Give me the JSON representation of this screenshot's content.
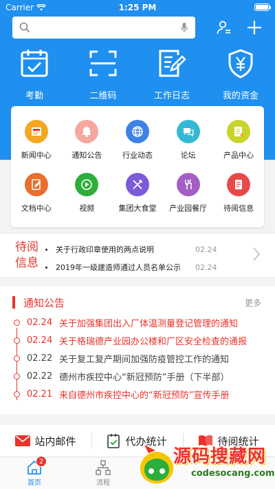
{
  "status_bar": {
    "carrier": "Carrier",
    "time": "1:25 PM"
  },
  "search": {
    "placeholder": ""
  },
  "quick_actions": [
    {
      "label": "考勤",
      "icon": "calendar-check-icon"
    },
    {
      "label": "二维码",
      "icon": "qr-scan-icon"
    },
    {
      "label": "工作日志",
      "icon": "work-log-icon"
    },
    {
      "label": "我的资金",
      "icon": "yuan-shield-icon"
    }
  ],
  "apps": [
    {
      "label": "新闻中心",
      "icon": "news-icon",
      "color": "#f5a623"
    },
    {
      "label": "通知公告",
      "icon": "bell-icon",
      "color": "#f6a7a0"
    },
    {
      "label": "行业动态",
      "icon": "globe-icon",
      "color": "#3e82e6"
    },
    {
      "label": "论坛",
      "icon": "chat-icon",
      "color": "#35b8d6"
    },
    {
      "label": "产品中心",
      "icon": "product-icon",
      "color": "#c8d42b"
    },
    {
      "label": "文档中心",
      "icon": "document-edit-icon",
      "color": "#e86f2c"
    },
    {
      "label": "视频",
      "icon": "play-icon",
      "color": "#2dae3b"
    },
    {
      "label": "集团大食堂",
      "icon": "dining-icon",
      "color": "#7d5ad8"
    },
    {
      "label": "产业园餐厅",
      "icon": "restaurant-icon",
      "color": "#a35fc4"
    },
    {
      "label": "待阅信息",
      "icon": "pending-doc-icon",
      "color": "#e84a4a"
    }
  ],
  "pending": {
    "label_line1": "待阅",
    "label_line2": "信息",
    "items": [
      {
        "title": "关于行政印章使用的两点说明",
        "date": "02.24"
      },
      {
        "title": "2019年一级建造师通过人员名单公示",
        "date": "02.24"
      }
    ]
  },
  "notice": {
    "title": "通知公告",
    "more": "更多",
    "items": [
      {
        "date": "02.24",
        "title": "关于加强集团出入厂体温测量登记管理的通知",
        "state": "red"
      },
      {
        "date": "02.24",
        "title": "关于格瑞德产业园办公楼和厂区安全检查的通报",
        "state": "red"
      },
      {
        "date": "02.22",
        "title": "关于复工复产期间加强防疫管控工作的通知",
        "state": "gray"
      },
      {
        "date": "02.22",
        "title": "德州市疾控中心“新冠预防”手册（下半部）",
        "state": "gray"
      },
      {
        "date": "02.21",
        "title": "来自德州市疾控中心的“新冠预防”宣传手册",
        "state": "red"
      }
    ]
  },
  "stats": [
    {
      "label": "站内邮件",
      "icon": "mail-icon"
    },
    {
      "label": "代办统计",
      "icon": "checklist-icon"
    },
    {
      "label": "待阅统计",
      "icon": "book-icon"
    }
  ],
  "tabs": [
    {
      "label": "首页",
      "icon": "home-icon",
      "active": true,
      "badge": "2"
    },
    {
      "label": "流程",
      "icon": "flow-icon",
      "active": false
    }
  ],
  "watermark": {
    "title": "源码搜藏网",
    "url": "codesocang.com"
  },
  "colors": {
    "primary": "#1f8ff0",
    "accent_red": "#e8332c"
  }
}
